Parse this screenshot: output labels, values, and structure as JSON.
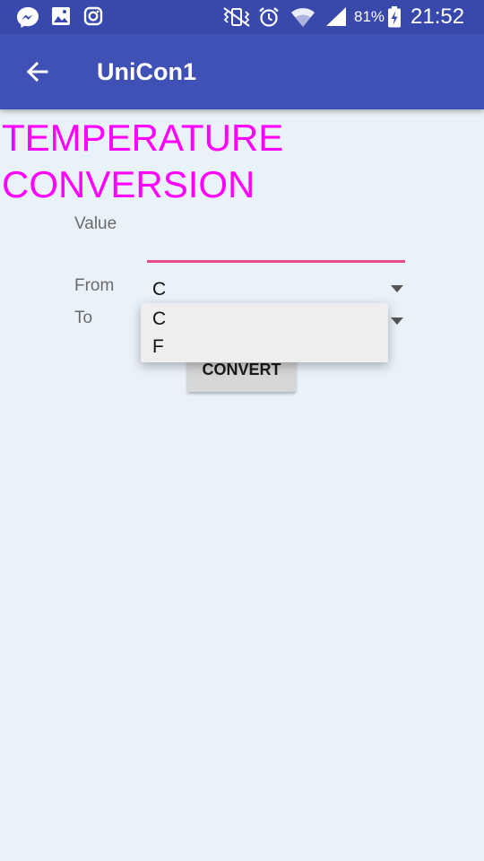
{
  "status_bar": {
    "battery": "81%",
    "time": "21:52",
    "icons": [
      "messenger-icon",
      "gallery-icon",
      "instagram-icon",
      "vibrate-icon",
      "alarm-icon",
      "wifi-icon",
      "signal-icon",
      "battery-charging-icon"
    ]
  },
  "app_bar": {
    "title": "UniCon1",
    "back_icon": "arrow-back-icon",
    "color": "#3f51b5"
  },
  "content": {
    "heading": "TEMPERATURE CONVERSION",
    "heading_color": "#ff00ff",
    "value_label": "Value",
    "value_input": "",
    "from_label": "From",
    "from_selected": "C",
    "to_label": "To",
    "to_selected": "",
    "convert_label": "CONVERT"
  },
  "dropdown": {
    "options": [
      "C",
      "F"
    ]
  }
}
